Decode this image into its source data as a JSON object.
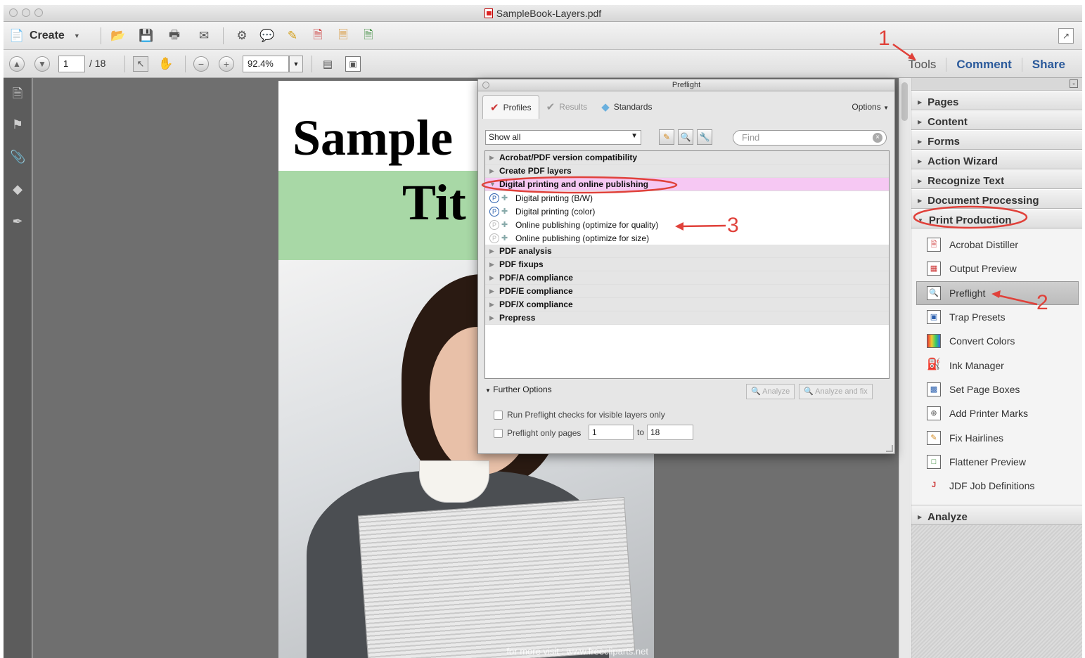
{
  "window": {
    "title": "SampleBook-Layers.pdf"
  },
  "toolbar": {
    "create_label": "Create",
    "icons": [
      "open-folder-icon",
      "save-icon",
      "print-icon",
      "email-icon",
      "settings-icon",
      "comment-icon",
      "highlight-icon",
      "pdf-tools-icon",
      "export-icon",
      "sign-icon"
    ]
  },
  "nav": {
    "page_current": "1",
    "page_total": "/ 18",
    "zoom": "92.4%"
  },
  "links": {
    "tools": "Tools",
    "comment": "Comment",
    "share": "Share"
  },
  "document": {
    "title_line1": "Sample",
    "title_line2": "Tit",
    "watermark": "for more visit : www.freecliparts.net"
  },
  "preflight": {
    "title": "Preflight",
    "tabs": {
      "profiles": "Profiles",
      "results": "Results",
      "standards": "Standards"
    },
    "options": "Options",
    "filter": "Show all",
    "find_placeholder": "Find",
    "tree": {
      "cat1": "Acrobat/PDF version compatibility",
      "cat2": "Create PDF layers",
      "cat3": "Digital printing and online publishing",
      "child1": "Digital printing (B/W)",
      "child2": "Digital printing (color)",
      "child3": "Online publishing (optimize for quality)",
      "child4": "Online publishing (optimize for size)",
      "cat4": "PDF analysis",
      "cat5": "PDF fixups",
      "cat6": "PDF/A compliance",
      "cat7": "PDF/E compliance",
      "cat8": "PDF/X compliance",
      "cat9": "Prepress"
    },
    "further_options": "Further Options",
    "analyze": "Analyze",
    "analyze_fix": "Analyze and fix",
    "check_layers": "Run Preflight checks for visible layers only",
    "check_pages": "Preflight only pages",
    "pages_from": "1",
    "pages_to_label": "to",
    "pages_to": "18"
  },
  "tools_panel": {
    "sections": {
      "pages": "Pages",
      "content": "Content",
      "forms": "Forms",
      "action_wizard": "Action Wizard",
      "recognize_text": "Recognize Text",
      "document_processing": "Document Processing",
      "print_production": "Print Production",
      "analyze": "Analyze"
    },
    "items": {
      "acrobat_distiller": "Acrobat Distiller",
      "output_preview": "Output Preview",
      "preflight": "Preflight",
      "trap_presets": "Trap Presets",
      "convert_colors": "Convert Colors",
      "ink_manager": "Ink Manager",
      "set_page_boxes": "Set Page Boxes",
      "add_printer_marks": "Add Printer Marks",
      "fix_hairlines": "Fix Hairlines",
      "flattener_preview": "Flattener Preview",
      "jdf_job_definitions": "JDF Job Definitions"
    }
  },
  "annotations": {
    "n1": "1",
    "n2": "2",
    "n3": "3"
  },
  "colors": {
    "annotation": "#e0413a",
    "selected_row": "#f6c8f3",
    "link": "#2b5a9b"
  }
}
